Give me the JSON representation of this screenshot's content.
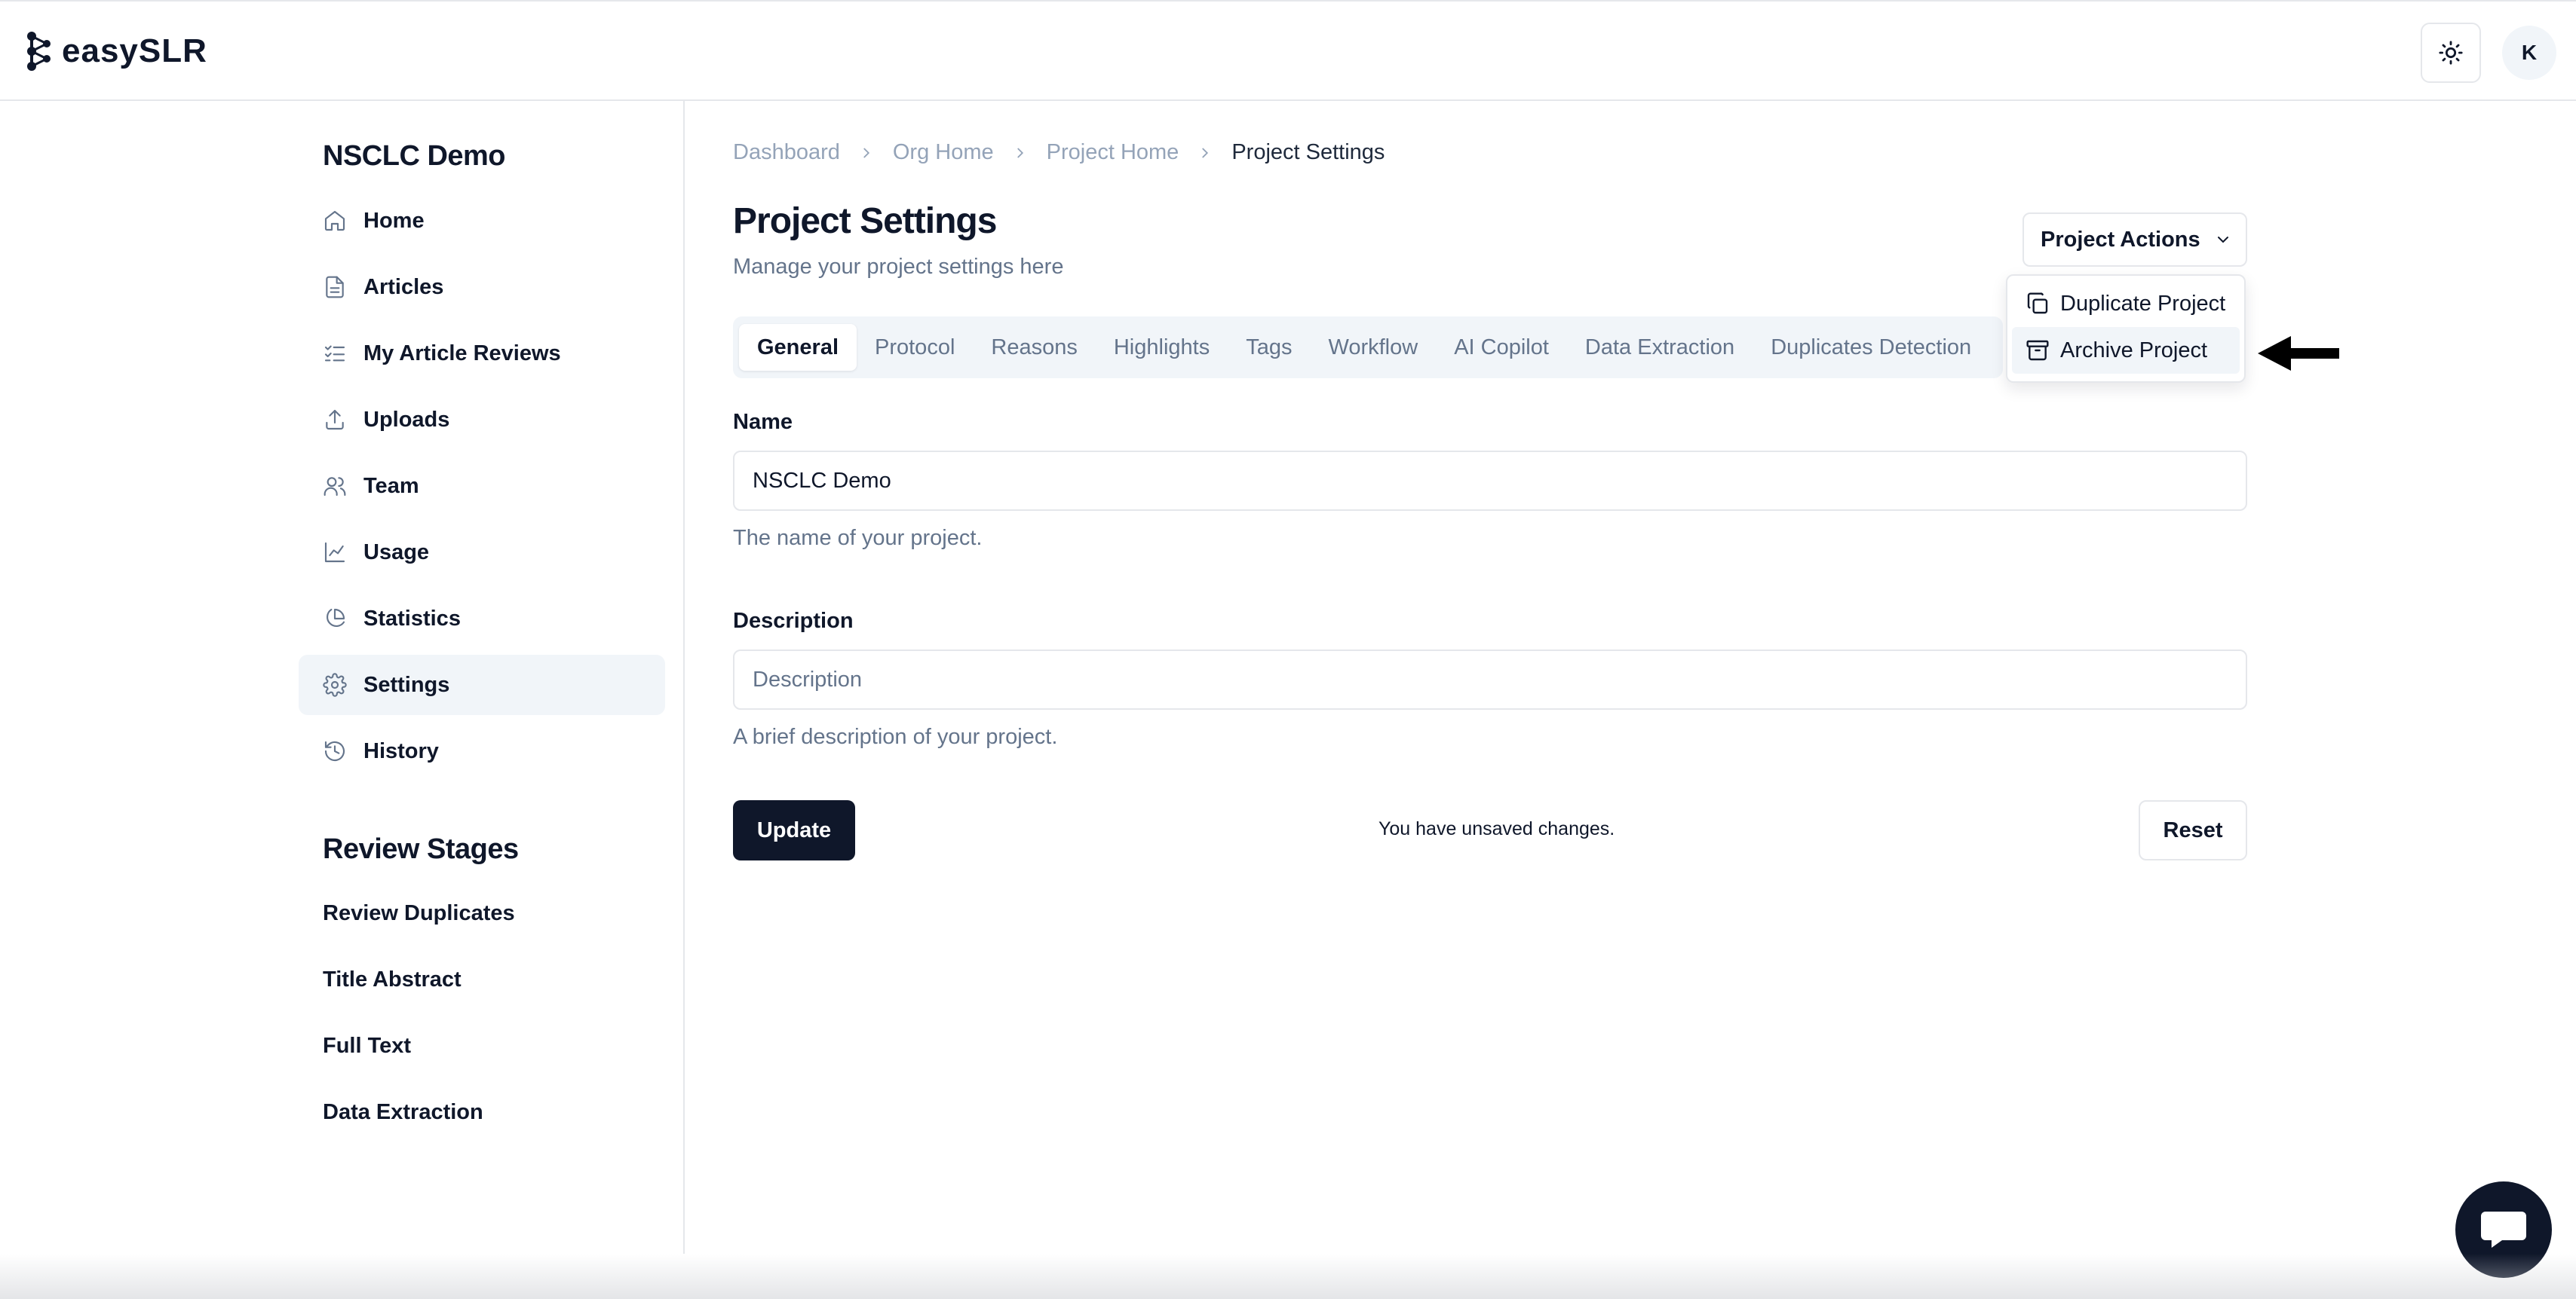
{
  "app": {
    "name": "easySLR"
  },
  "header": {
    "avatar_initial": "K"
  },
  "sidebar": {
    "org_title": "NSCLC Demo",
    "items": [
      {
        "label": "Home",
        "icon": "home-icon"
      },
      {
        "label": "Articles",
        "icon": "file-icon"
      },
      {
        "label": "My Article Reviews",
        "icon": "list-checks-icon"
      },
      {
        "label": "Uploads",
        "icon": "upload-icon"
      },
      {
        "label": "Team",
        "icon": "users-icon"
      },
      {
        "label": "Usage",
        "icon": "line-chart-icon"
      },
      {
        "label": "Statistics",
        "icon": "pie-chart-icon"
      },
      {
        "label": "Settings",
        "icon": "gear-icon",
        "active": true
      },
      {
        "label": "History",
        "icon": "history-icon"
      }
    ],
    "stages_title": "Review Stages",
    "stages": [
      "Review Duplicates",
      "Title Abstract",
      "Full Text",
      "Data Extraction"
    ]
  },
  "breadcrumb": [
    "Dashboard",
    "Org Home",
    "Project Home",
    "Project Settings"
  ],
  "main": {
    "title": "Project Settings",
    "subtitle": "Manage your project settings here",
    "actions_label": "Project Actions",
    "actions_menu": [
      {
        "label": "Duplicate Project",
        "icon": "copy-icon"
      },
      {
        "label": "Archive Project",
        "icon": "archive-icon",
        "highlighted": true
      }
    ],
    "tabs": [
      "General",
      "Protocol",
      "Reasons",
      "Highlights",
      "Tags",
      "Workflow",
      "AI Copilot",
      "Data Extraction",
      "Duplicates Detection"
    ],
    "active_tab": "General",
    "form": {
      "name_label": "Name",
      "name_value": "NSCLC Demo",
      "name_help": "The name of your project.",
      "description_label": "Description",
      "description_placeholder": "Description",
      "description_help": "A brief description of your project."
    },
    "update_label": "Update",
    "unsaved_text": "You have unsaved changes.",
    "reset_label": "Reset"
  },
  "colors": {
    "primary": "#0f172a",
    "muted": "#64748b",
    "border": "#e5e7eb",
    "accent_bg": "#f1f5f9"
  }
}
